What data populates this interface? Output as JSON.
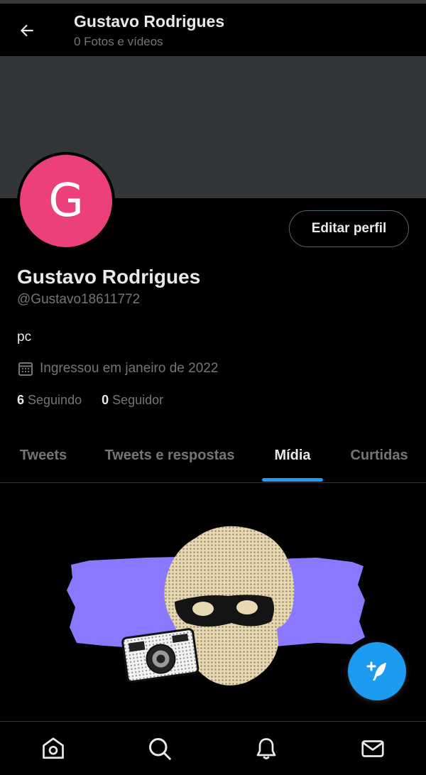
{
  "header": {
    "title": "Gustavo Rodrigues",
    "subtitle": "0 Fotos e vídeos"
  },
  "profile": {
    "avatar_letter": "G",
    "avatar_color": "#ec407a",
    "banner_color": "#333639",
    "edit_label": "Editar perfil",
    "name": "Gustavo Rodrigues",
    "handle": "@Gustavo18611772",
    "bio": "pc",
    "joined": "Ingressou em janeiro de 2022",
    "following_count": "6",
    "following_label": "Seguindo",
    "followers_count": "0",
    "followers_label": "Seguidor"
  },
  "tabs": [
    {
      "label": "Tweets",
      "active": false
    },
    {
      "label": "Tweets e respostas",
      "active": false
    },
    {
      "label": "Mídia",
      "active": true
    },
    {
      "label": "Curtidas",
      "active": false
    }
  ],
  "colors": {
    "accent": "#1d9bf0",
    "illustration_purple": "#8a78ff"
  },
  "nav": [
    {
      "icon": "home-icon"
    },
    {
      "icon": "search-icon"
    },
    {
      "icon": "bell-icon"
    },
    {
      "icon": "mail-icon"
    }
  ],
  "fab": {
    "icon": "compose-tweet-icon"
  }
}
